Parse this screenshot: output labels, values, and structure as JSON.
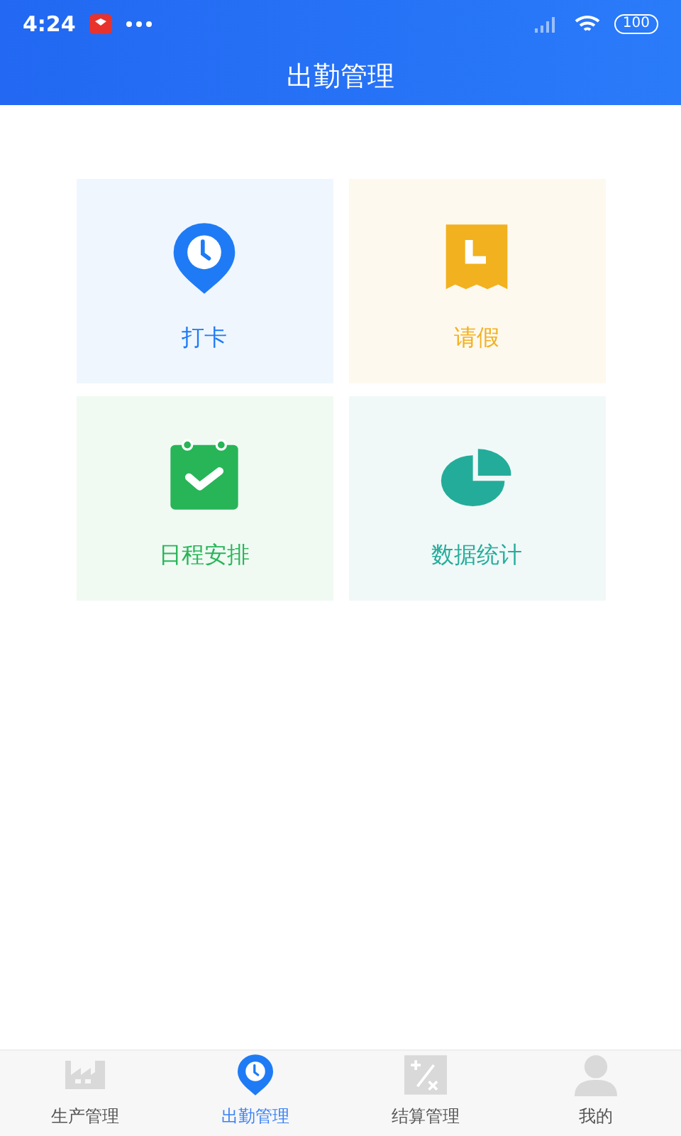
{
  "status_bar": {
    "time": "4:24",
    "battery": "100"
  },
  "header": {
    "title": "出勤管理"
  },
  "tiles": [
    {
      "label": "打卡",
      "kind": "clock-pin",
      "color": "#1e7bf5"
    },
    {
      "label": "请假",
      "kind": "ticket",
      "color": "#f2b11e"
    },
    {
      "label": "日程安排",
      "kind": "calendar",
      "color": "#27b557"
    },
    {
      "label": "数据统计",
      "kind": "pie",
      "color": "#24ac9a"
    }
  ],
  "tab_bar": [
    {
      "label": "生产管理",
      "kind": "factory",
      "selected": false
    },
    {
      "label": "出勤管理",
      "kind": "clock-pin",
      "selected": true
    },
    {
      "label": "结算管理",
      "kind": "calc",
      "selected": false
    },
    {
      "label": "我的",
      "kind": "person",
      "selected": false
    }
  ]
}
